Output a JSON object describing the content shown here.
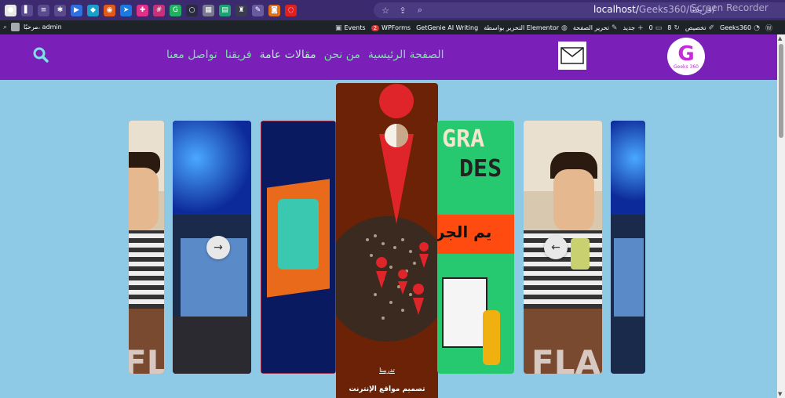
{
  "browser": {
    "url_host": "localhost/",
    "url_rest": "Geeks360/فريقنا/",
    "watermark": "Screen Recorder",
    "extensions": [
      {
        "name": "avatar",
        "color": "#e8e8e8",
        "glyph": "●"
      },
      {
        "name": "sidebar",
        "color": "#5a4a90",
        "glyph": "▌"
      },
      {
        "name": "playlist",
        "color": "#5a4a90",
        "glyph": "≡"
      },
      {
        "name": "puzzle",
        "color": "#5a4a90",
        "glyph": "✱"
      },
      {
        "name": "ext-blue",
        "color": "#2f6fe0",
        "glyph": "▶"
      },
      {
        "name": "ext-teal",
        "color": "#1aa0c8",
        "glyph": "◆"
      },
      {
        "name": "ext-firefox",
        "color": "#e05a1a",
        "glyph": "◉"
      },
      {
        "name": "ext-send",
        "color": "#1a7ae0",
        "glyph": "➤"
      },
      {
        "name": "ext-pink",
        "color": "#e0308a",
        "glyph": "✚"
      },
      {
        "name": "ext-slack",
        "color": "#c8307a",
        "glyph": "#"
      },
      {
        "name": "ext-green",
        "color": "#20b060",
        "glyph": "G"
      },
      {
        "name": "ext-dark",
        "color": "#2a2a40",
        "glyph": "○"
      },
      {
        "name": "ext-grey",
        "color": "#7a7a90",
        "glyph": "▦"
      },
      {
        "name": "ext-doc",
        "color": "#20a070",
        "glyph": "▤"
      },
      {
        "name": "ext-chess",
        "color": "#3a3a50",
        "glyph": "♜"
      },
      {
        "name": "ext-brush",
        "color": "#6a5aa0",
        "glyph": "✎"
      },
      {
        "name": "ext-cam",
        "color": "#e0701a",
        "glyph": "◙"
      },
      {
        "name": "ext-red",
        "color": "#e02020",
        "glyph": "◌"
      }
    ]
  },
  "admin_bar": {
    "greeting": "مرحبًا، admin",
    "events": "Events",
    "wpforms_badge": "2",
    "wpforms": "WPForms",
    "getgenie": "GetGenie AI Writing",
    "elementor": "التحرير بواسطة Elementor",
    "edit_page": "تحرير الصفحة",
    "new": "جديد",
    "comments_count": "0",
    "updates_count": "8",
    "customize": "تخصيص",
    "site_name": "Geeks360"
  },
  "header": {
    "nav": [
      {
        "label": "الصفحة الرئيسية",
        "active": false
      },
      {
        "label": "من نحن",
        "active": false
      },
      {
        "label": "مقالات عامة",
        "active": true
      },
      {
        "label": "فريقنا",
        "active": false
      },
      {
        "label": "تواصل معنا",
        "active": false
      }
    ],
    "brand_letter": "G",
    "brand_sub": "Geeks 360"
  },
  "slider": {
    "active_category": "تدريبنا",
    "active_title": "تصميم مواقع الإنترنت",
    "next_arrow": "→",
    "prev_arrow": "←",
    "card_fl_text": "FLAI",
    "card_gd_text_1": "GRA",
    "card_gd_text_2": "DES",
    "card_ar_banner": "يم الجر"
  },
  "colors": {
    "page_bg": "#8ecae6",
    "header_bg": "#7a1fb8",
    "nav_text": "#7ee0a8",
    "browser_bg": "#3b2a6e",
    "admin_bg": "#1d2327"
  }
}
